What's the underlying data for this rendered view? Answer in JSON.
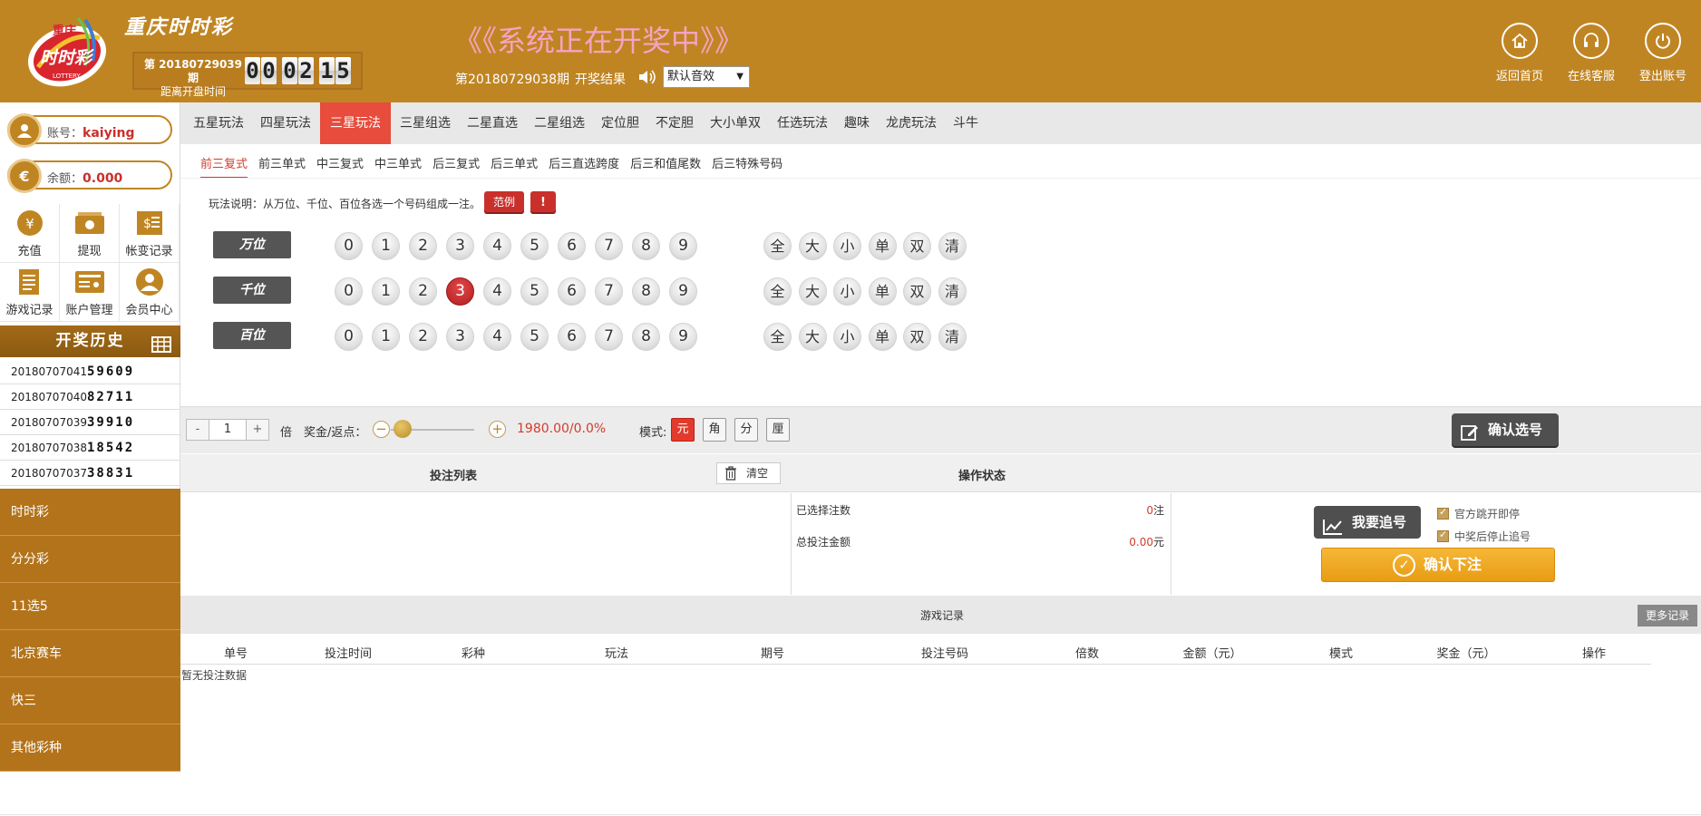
{
  "header": {
    "lottery_name": "重庆时时彩",
    "current_issue_line": "第 20180729039 期",
    "countdown_label": "距离开盘时间",
    "countdown_digits": [
      "0",
      "0",
      "0",
      "2",
      "1",
      "5"
    ],
    "status_title": "《《系统正在开奖中》》",
    "last_issue": "第20180729038期",
    "last_result_label": "开奖结果",
    "sound_select": "默认音效",
    "nav": [
      {
        "label": "返回首页",
        "icon": "home-icon"
      },
      {
        "label": "在线客服",
        "icon": "headset-icon"
      },
      {
        "label": "登出账号",
        "icon": "power-icon"
      }
    ],
    "brand_color": "#c08523"
  },
  "sidebar": {
    "account_label": "账号：",
    "account_value": "kaiying",
    "balance_label": "余额：",
    "balance_value": "0.000",
    "quick_links": [
      {
        "label": "充值",
        "icon": "yen-coin-icon"
      },
      {
        "label": "提现",
        "icon": "cash-icon"
      },
      {
        "label": "帐变记录",
        "icon": "ledger-icon"
      },
      {
        "label": "游戏记录",
        "icon": "document-icon"
      },
      {
        "label": "账户管理",
        "icon": "id-card-icon"
      },
      {
        "label": "会员中心",
        "icon": "member-icon"
      }
    ],
    "history_title": "开奖历史",
    "history": [
      {
        "issue": "20180707041",
        "numbers": "59609"
      },
      {
        "issue": "20180707040",
        "numbers": "82711"
      },
      {
        "issue": "20180707039",
        "numbers": "39910"
      },
      {
        "issue": "20180707038",
        "numbers": "18542"
      },
      {
        "issue": "20180707037",
        "numbers": "38831"
      }
    ],
    "categories": [
      "时时彩",
      "分分彩",
      "11选5",
      "北京赛车",
      "快三",
      "其他彩种"
    ]
  },
  "play_tabs": [
    "五星玩法",
    "四星玩法",
    "三星玩法",
    "三星组选",
    "二星直选",
    "二星组选",
    "定位胆",
    "不定胆",
    "大小单双",
    "任选玩法",
    "趣味",
    "龙虎玩法",
    "斗牛"
  ],
  "active_play_tab": "三星玩法",
  "sub_tabs": [
    "前三复式",
    "前三单式",
    "中三复式",
    "中三单式",
    "后三复式",
    "后三单式",
    "后三直选跨度",
    "后三和值尾数",
    "后三特殊号码"
  ],
  "active_sub_tab": "前三复式",
  "play_desc": "玩法说明：从万位、千位、百位各选一个号码组成一注。",
  "example_label": "范例",
  "warn_label": "!",
  "rows": [
    {
      "label": "万位",
      "selected": null
    },
    {
      "label": "千位",
      "selected": 3
    },
    {
      "label": "百位",
      "selected": null
    }
  ],
  "digits": [
    "0",
    "1",
    "2",
    "3",
    "4",
    "5",
    "6",
    "7",
    "8",
    "9"
  ],
  "quick_picks": [
    "全",
    "大",
    "小",
    "单",
    "双",
    "清"
  ],
  "bet_bar": {
    "minus": "-",
    "multiplier": "1",
    "plus": "+",
    "multi_label": "倍",
    "rebate_label": "奖金/返点：",
    "rebate_minus": "−",
    "rebate_plus": "+",
    "rebate_value": "1980.00/0.0%",
    "rebate_level": 0.0,
    "mode_label": "模式:",
    "modes": [
      "元",
      "角",
      "分",
      "厘"
    ],
    "active_mode": "元",
    "confirm_select": "确认选号"
  },
  "list_head": {
    "title": "投注列表",
    "clear": "清空",
    "status_title": "操作状态"
  },
  "stats": {
    "selected_label": "已选择注数",
    "selected_value": "0",
    "selected_unit": "注",
    "total_label": "总投注金额",
    "total_value": "0.00",
    "total_unit": "元"
  },
  "actions": {
    "chase": "我要追号",
    "check1": "官方跳开即停",
    "check2": "中奖后停止追号",
    "confirm_bet": "确认下注"
  },
  "records": {
    "title": "游戏记录",
    "more": "更多记录",
    "columns": [
      "单号",
      "投注时间",
      "彩种",
      "玩法",
      "期号",
      "投注号码",
      "倍数",
      "金额（元）",
      "模式",
      "奖金（元）",
      "操作"
    ],
    "empty": "暂无投注数据"
  }
}
